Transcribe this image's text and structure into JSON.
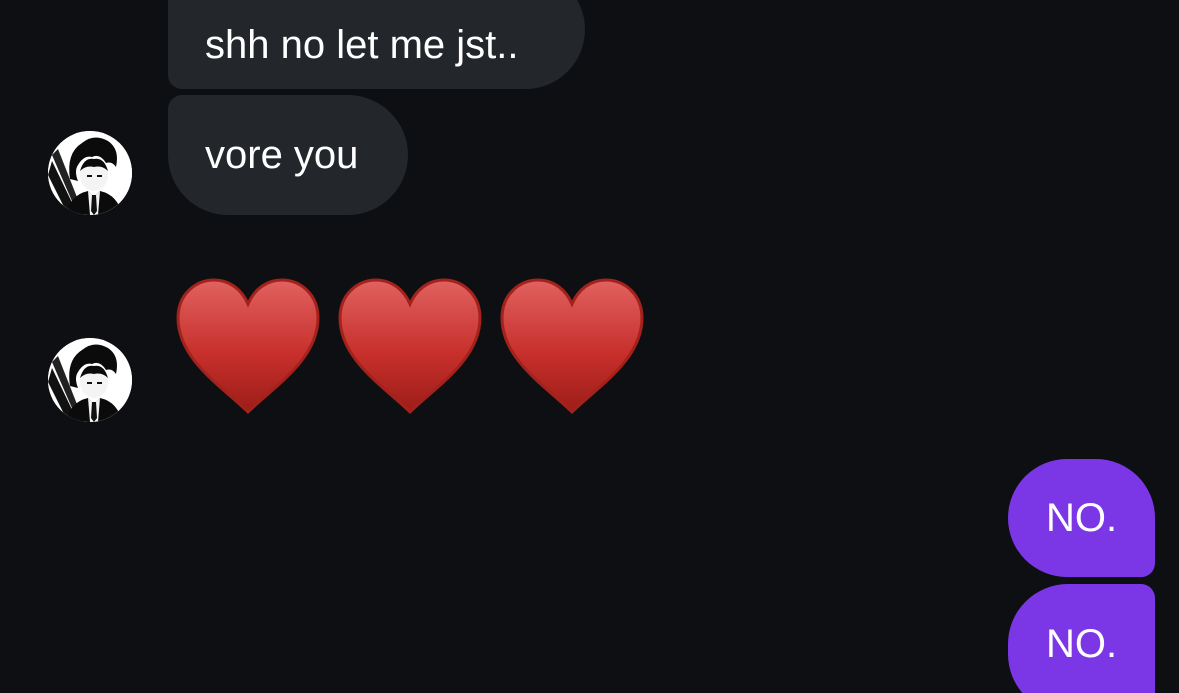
{
  "messages": [
    {
      "id": "m1",
      "direction": "incoming",
      "text": "shh no let me jst.."
    },
    {
      "id": "m2",
      "direction": "incoming",
      "text": "vore you"
    },
    {
      "id": "m3",
      "direction": "incoming",
      "emoji": [
        "heart",
        "heart",
        "heart"
      ]
    },
    {
      "id": "m4",
      "direction": "outgoing",
      "text": "NO."
    },
    {
      "id": "m5",
      "direction": "outgoing",
      "text": "NO."
    }
  ],
  "colors": {
    "background": "#0d0f13",
    "incoming_bubble": "#23262b",
    "outgoing_bubble": "#7b37e6",
    "heart": "#c8302c"
  },
  "icons": {
    "avatar": "anime-character-avatar-icon",
    "emoji": "red-heart-emoji-icon"
  }
}
